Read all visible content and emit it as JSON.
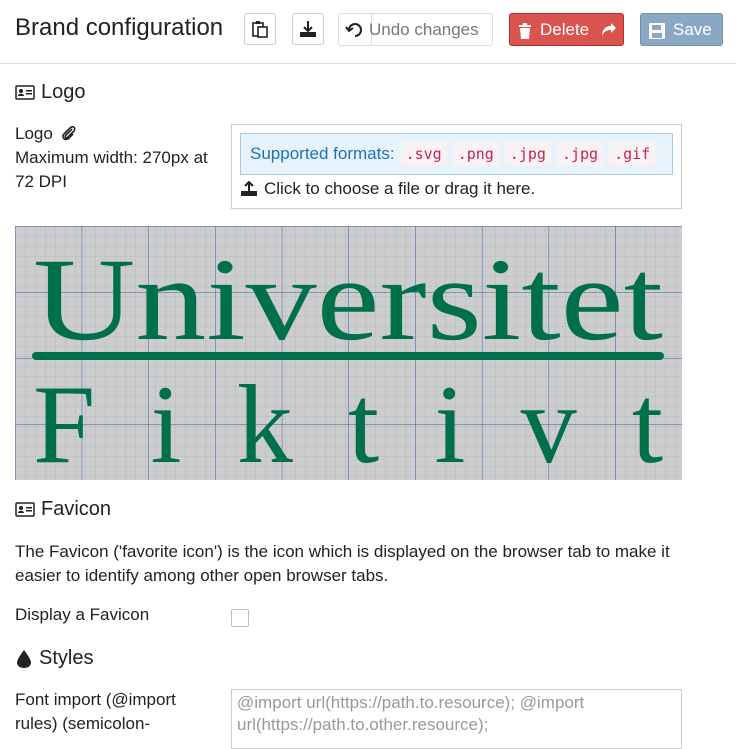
{
  "header": {
    "title": "Brand configuration",
    "undo_label": "Undo changes",
    "delete_label": "Delete",
    "save_label": "Save"
  },
  "logo_section": {
    "heading": "Logo",
    "field_label": "Logo",
    "max_width_text": "Maximum width: 270px at 72 DPI",
    "supported_label": "Supported formats:",
    "formats": [
      ".svg",
      ".png",
      ".jpg",
      ".jpg",
      ".gif"
    ],
    "choose_text": "Click to choose a file or drag it here.",
    "logo_line1": "Universitet",
    "logo_line2": "Fiktivt"
  },
  "favicon_section": {
    "heading": "Favicon",
    "description": "The Favicon ('favorite icon') is the icon which is displayed on the browser tab to make it easier to identify among other open browser tabs.",
    "display_label": "Display a Favicon"
  },
  "styles_section": {
    "heading": "Styles",
    "font_import_label": "Font import (@import rules) (semicolon-",
    "font_import_placeholder": "@import url(https://path.to.resource); @import url(https://path.to.other.resource);"
  },
  "colors": {
    "delete": "#d9534f",
    "save": "#8aa8c4",
    "logo_green": "#00704a",
    "formats_text": "#1e73b8"
  }
}
